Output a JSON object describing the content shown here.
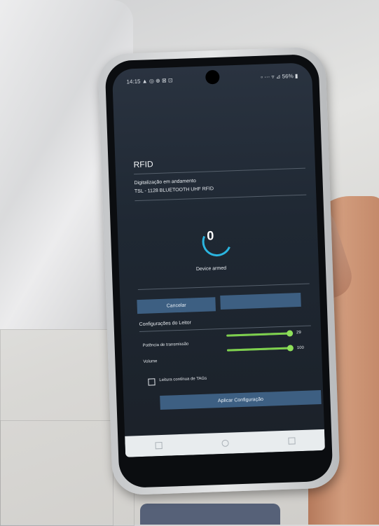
{
  "screen": {
    "status_bar": {
      "time": "14:15 ▲ ◎ ⊕ ⊠ ⊡",
      "right": "▫ ⋯ ▿ ⊿ 56% ▮"
    },
    "title": "RFID",
    "status_line1": "Digitalização em andamento",
    "status_line2": "TSL - 1128 BLUETOOTH UHF RFID",
    "count": "0",
    "device_status": "Device armed",
    "buttons": {
      "cancel": "Cancelar",
      "other": ""
    },
    "settings": {
      "title": "Configurações do Leitor",
      "power": {
        "label": "Potência de transmissão",
        "value": "29",
        "level": 1.0
      },
      "volume": {
        "label": "Volume",
        "value": "100",
        "level": 1.0
      },
      "continuous_checkbox": {
        "label": "Leitura contínua de TAGs",
        "checked": false
      },
      "apply_button": "Aplicar Configuração"
    }
  },
  "colors": {
    "screen_bg": "#1f2833",
    "button_bg": "#3d5f82",
    "slider_accent": "#7ed14d",
    "progress_accent": "#2bb5e0"
  }
}
